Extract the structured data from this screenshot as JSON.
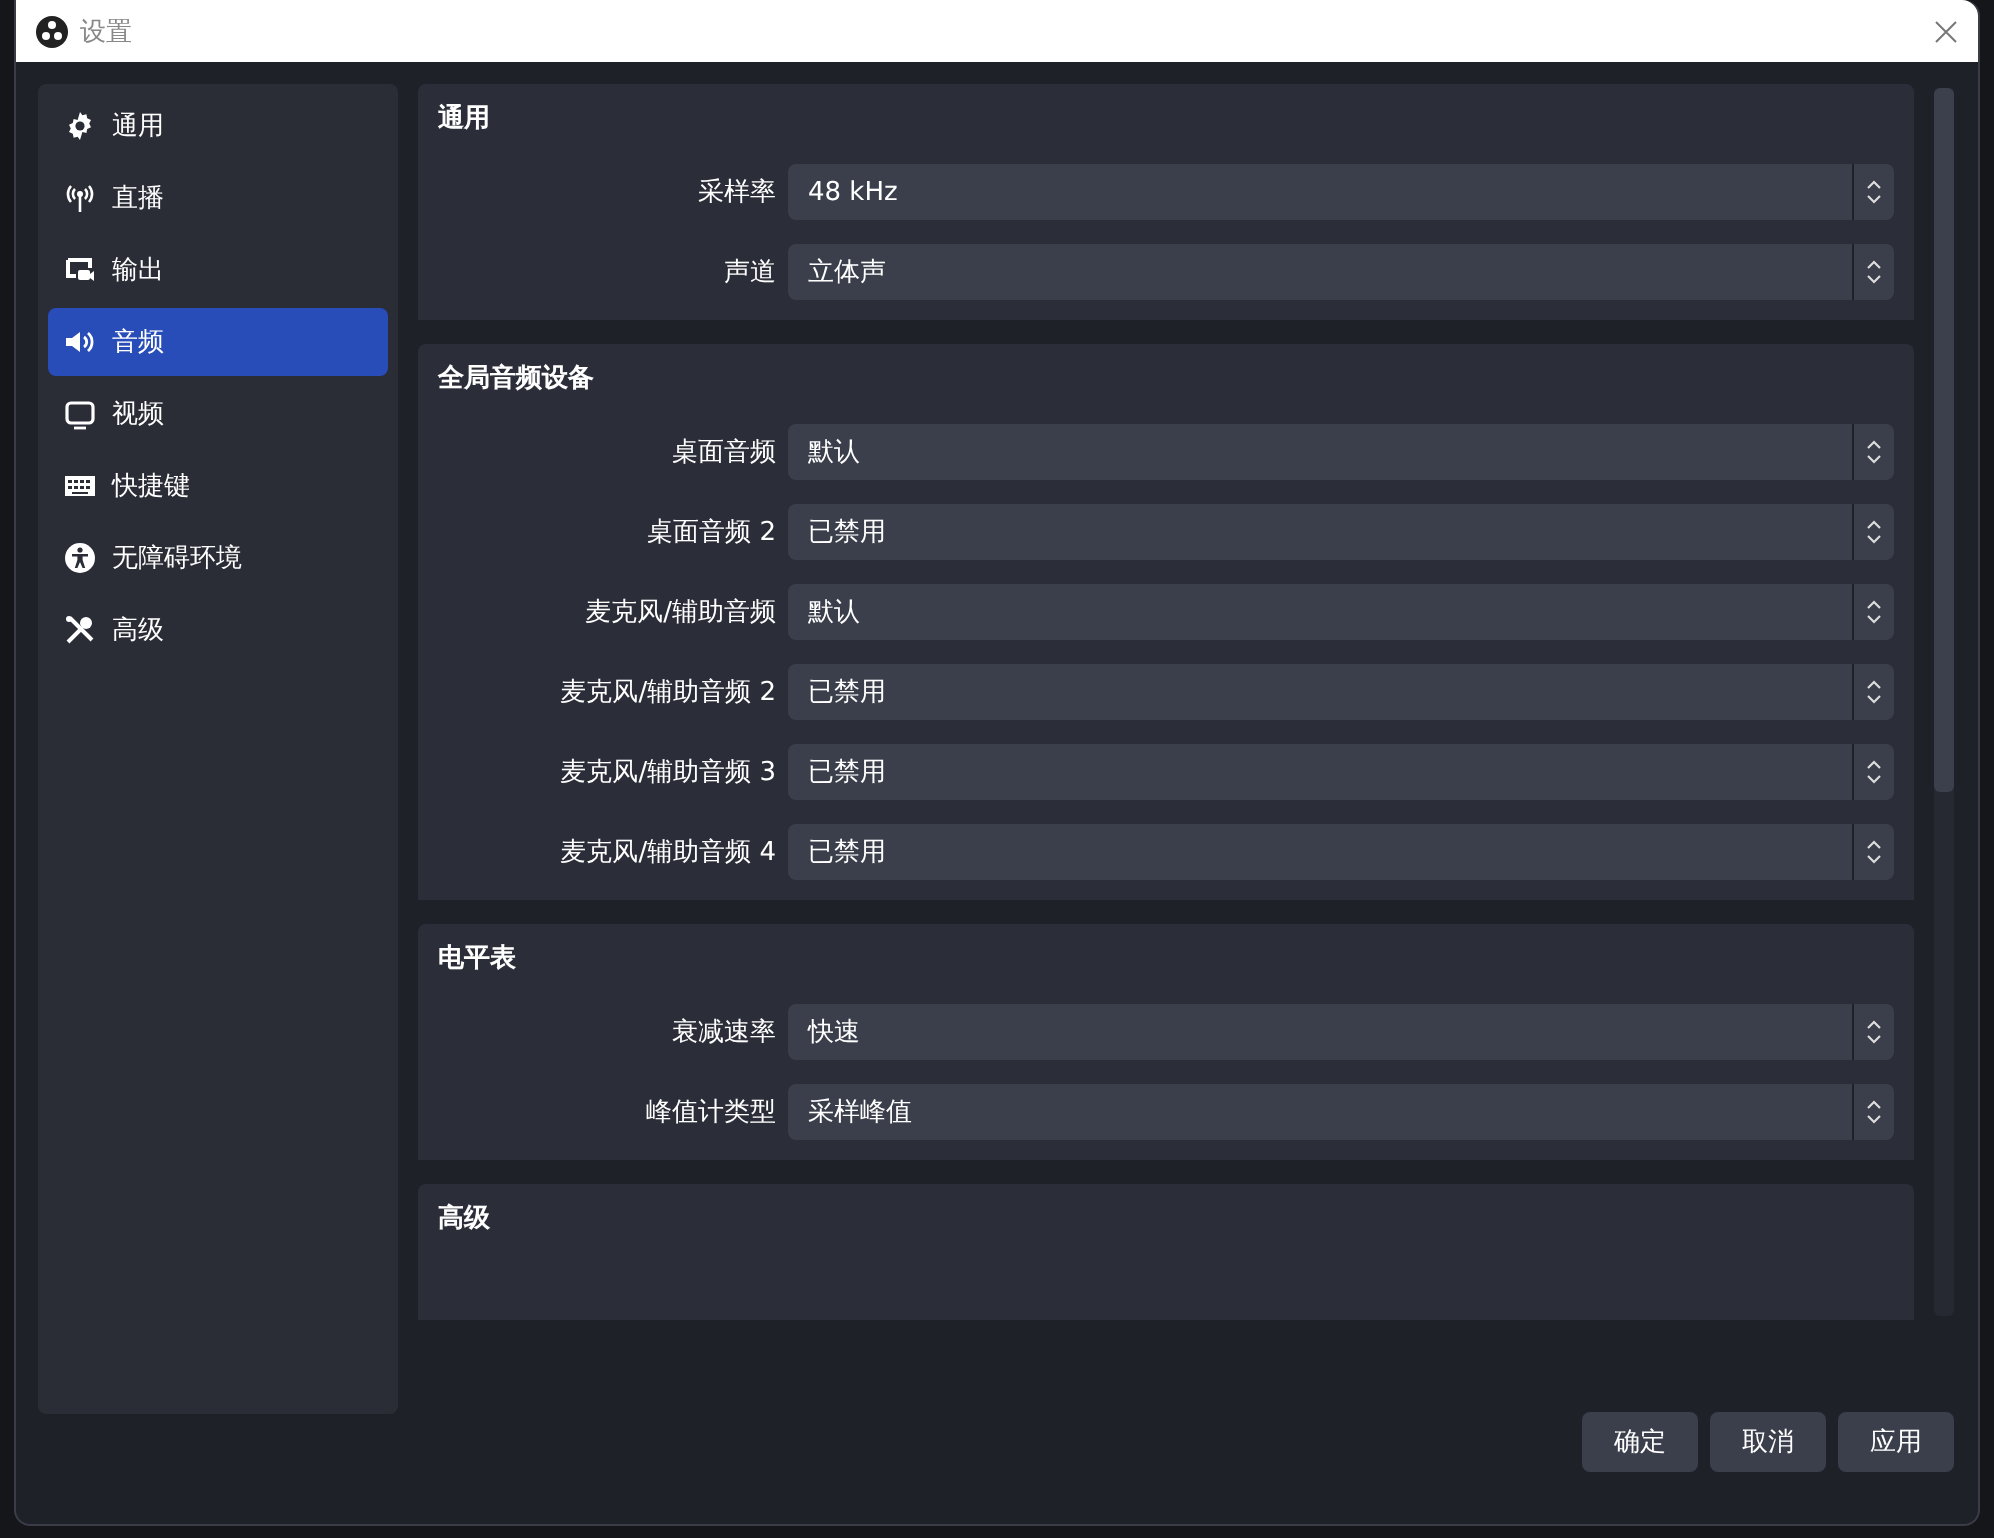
{
  "window": {
    "title": "设置"
  },
  "sidebar": {
    "items": [
      {
        "label": "通用",
        "selected": false
      },
      {
        "label": "直播",
        "selected": false
      },
      {
        "label": "输出",
        "selected": false
      },
      {
        "label": "音频",
        "selected": true
      },
      {
        "label": "视频",
        "selected": false
      },
      {
        "label": "快捷键",
        "selected": false
      },
      {
        "label": "无障碍环境",
        "selected": false
      },
      {
        "label": "高级",
        "selected": false
      }
    ]
  },
  "sections": [
    {
      "title": "通用",
      "rows": [
        {
          "label": "采样率",
          "value": "48 kHz"
        },
        {
          "label": "声道",
          "value": "立体声"
        }
      ]
    },
    {
      "title": "全局音频设备",
      "rows": [
        {
          "label": "桌面音频",
          "value": "默认"
        },
        {
          "label": "桌面音频 2",
          "value": "已禁用"
        },
        {
          "label": "麦克风/辅助音频",
          "value": "默认"
        },
        {
          "label": "麦克风/辅助音频 2",
          "value": "已禁用"
        },
        {
          "label": "麦克风/辅助音频 3",
          "value": "已禁用"
        },
        {
          "label": "麦克风/辅助音频 4",
          "value": "已禁用"
        }
      ]
    },
    {
      "title": "电平表",
      "rows": [
        {
          "label": "衰减速率",
          "value": "快速"
        },
        {
          "label": "峰值计类型",
          "value": "采样峰值"
        }
      ]
    },
    {
      "title": "高级"
    }
  ],
  "buttons": [
    "确定",
    "取消",
    "应用"
  ]
}
